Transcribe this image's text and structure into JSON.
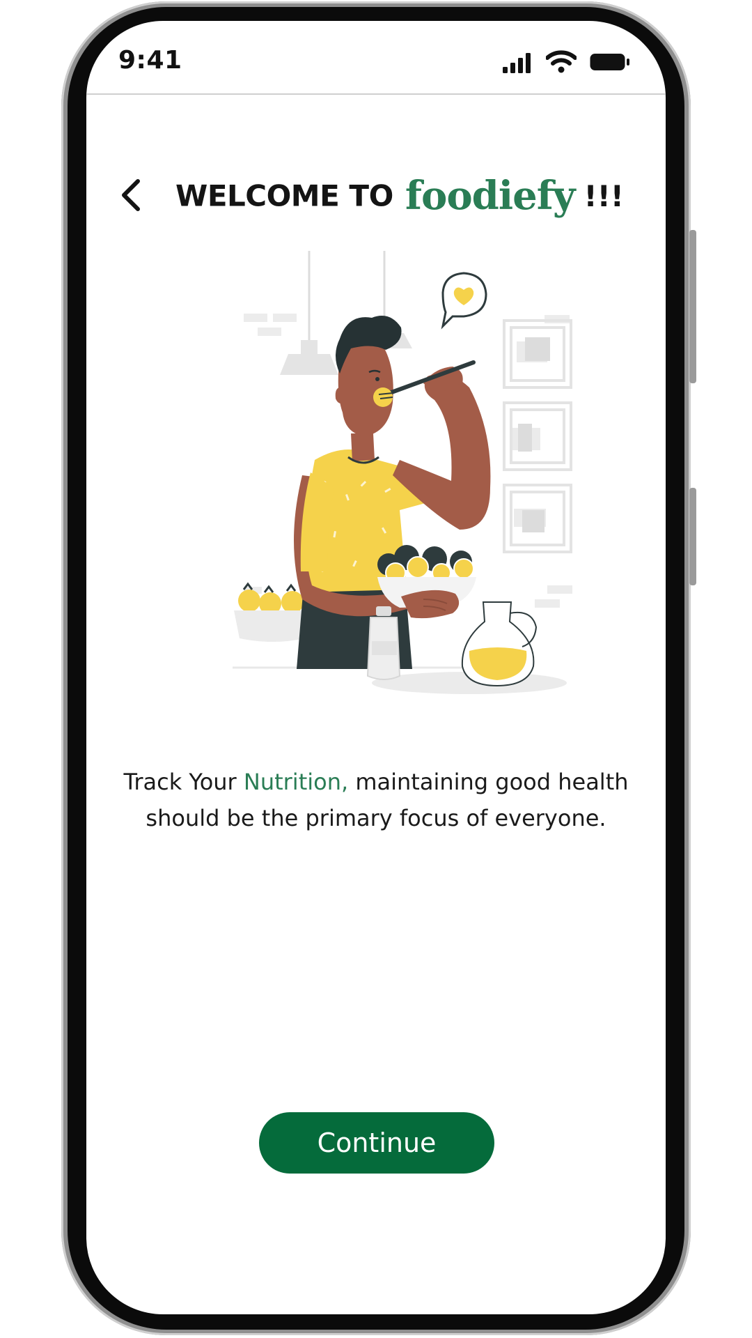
{
  "status_bar": {
    "time": "9:41"
  },
  "header": {
    "title_prefix": "WELCOME TO",
    "brand": "foodiefy",
    "title_suffix": "!!!"
  },
  "onboarding": {
    "text_start": "Track Your",
    "text_accent": "Nutrition,",
    "text_end": "maintaining good health should be the primary focus of everyone."
  },
  "actions": {
    "continue_label": "Continue"
  },
  "colors": {
    "brand_green": "#2a7d55",
    "button_green": "#056b3b",
    "illustration_yellow": "#f5d24b",
    "skin_brown": "#a35c48",
    "dark_slate": "#2e3b3d"
  },
  "icons": {
    "back": "chevron-left-icon",
    "signal": "cellular-signal-icon",
    "wifi": "wifi-icon",
    "battery": "battery-icon"
  }
}
